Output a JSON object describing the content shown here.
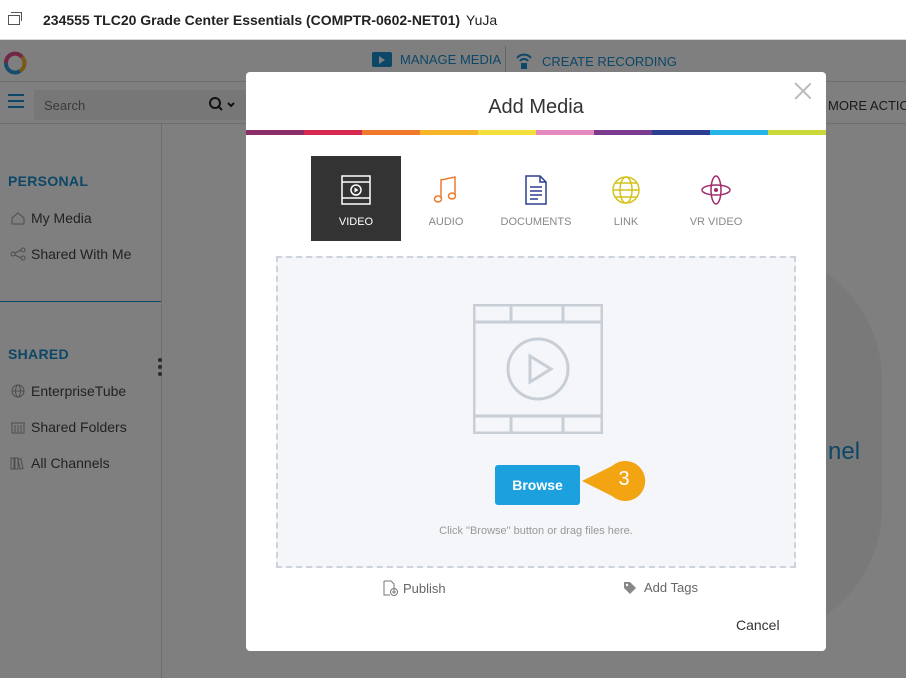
{
  "window": {
    "course_title": "234555 TLC20 Grade Center Essentials (COMPTR-0602-NET01)",
    "app_name": "YuJa"
  },
  "topnav": {
    "manage_media": "MANAGE MEDIA",
    "create_recording": "CREATE RECORDING",
    "more_actions": "MORE ACTION"
  },
  "search": {
    "placeholder": "Search"
  },
  "sidebar": {
    "personal_heading": "PERSONAL",
    "personal_items": [
      {
        "label": "My Media",
        "icon": "home-icon"
      },
      {
        "label": "Shared With Me",
        "icon": "share-icon"
      }
    ],
    "shared_heading": "SHARED",
    "shared_items": [
      {
        "label": "EnterpriseTube",
        "icon": "globe-icon"
      },
      {
        "label": "Shared Folders",
        "icon": "building-icon"
      },
      {
        "label": "All Channels",
        "icon": "library-icon"
      }
    ]
  },
  "background": {
    "channel_fragment": "nel"
  },
  "modal": {
    "title": "Add Media",
    "stripe_colors": [
      "#8b2f6b",
      "#d6294f",
      "#ef7a2b",
      "#f7b52a",
      "#f4e03b",
      "#e589c0",
      "#7a3b8f",
      "#2c3e8f",
      "#25b4e6",
      "#cbd83a"
    ],
    "tabs": [
      {
        "label": "VIDEO",
        "icon": "video-icon",
        "active": true
      },
      {
        "label": "AUDIO",
        "icon": "music-note-icon",
        "active": false
      },
      {
        "label": "DOCUMENTS",
        "icon": "document-icon",
        "active": false
      },
      {
        "label": "LINK",
        "icon": "globe-icon",
        "active": false
      },
      {
        "label": "VR VIDEO",
        "icon": "vr-orbit-icon",
        "active": false
      }
    ],
    "browse_label": "Browse",
    "drop_hint": "Click \"Browse\" button or drag files here.",
    "callout_number": "3",
    "publish_label": "Publish",
    "add_tags_label": "Add Tags",
    "cancel_label": "Cancel"
  },
  "colors": {
    "accent": "#1a8fce",
    "browse": "#1ca0de",
    "callout": "#f2a413",
    "active_tab": "#333333"
  }
}
